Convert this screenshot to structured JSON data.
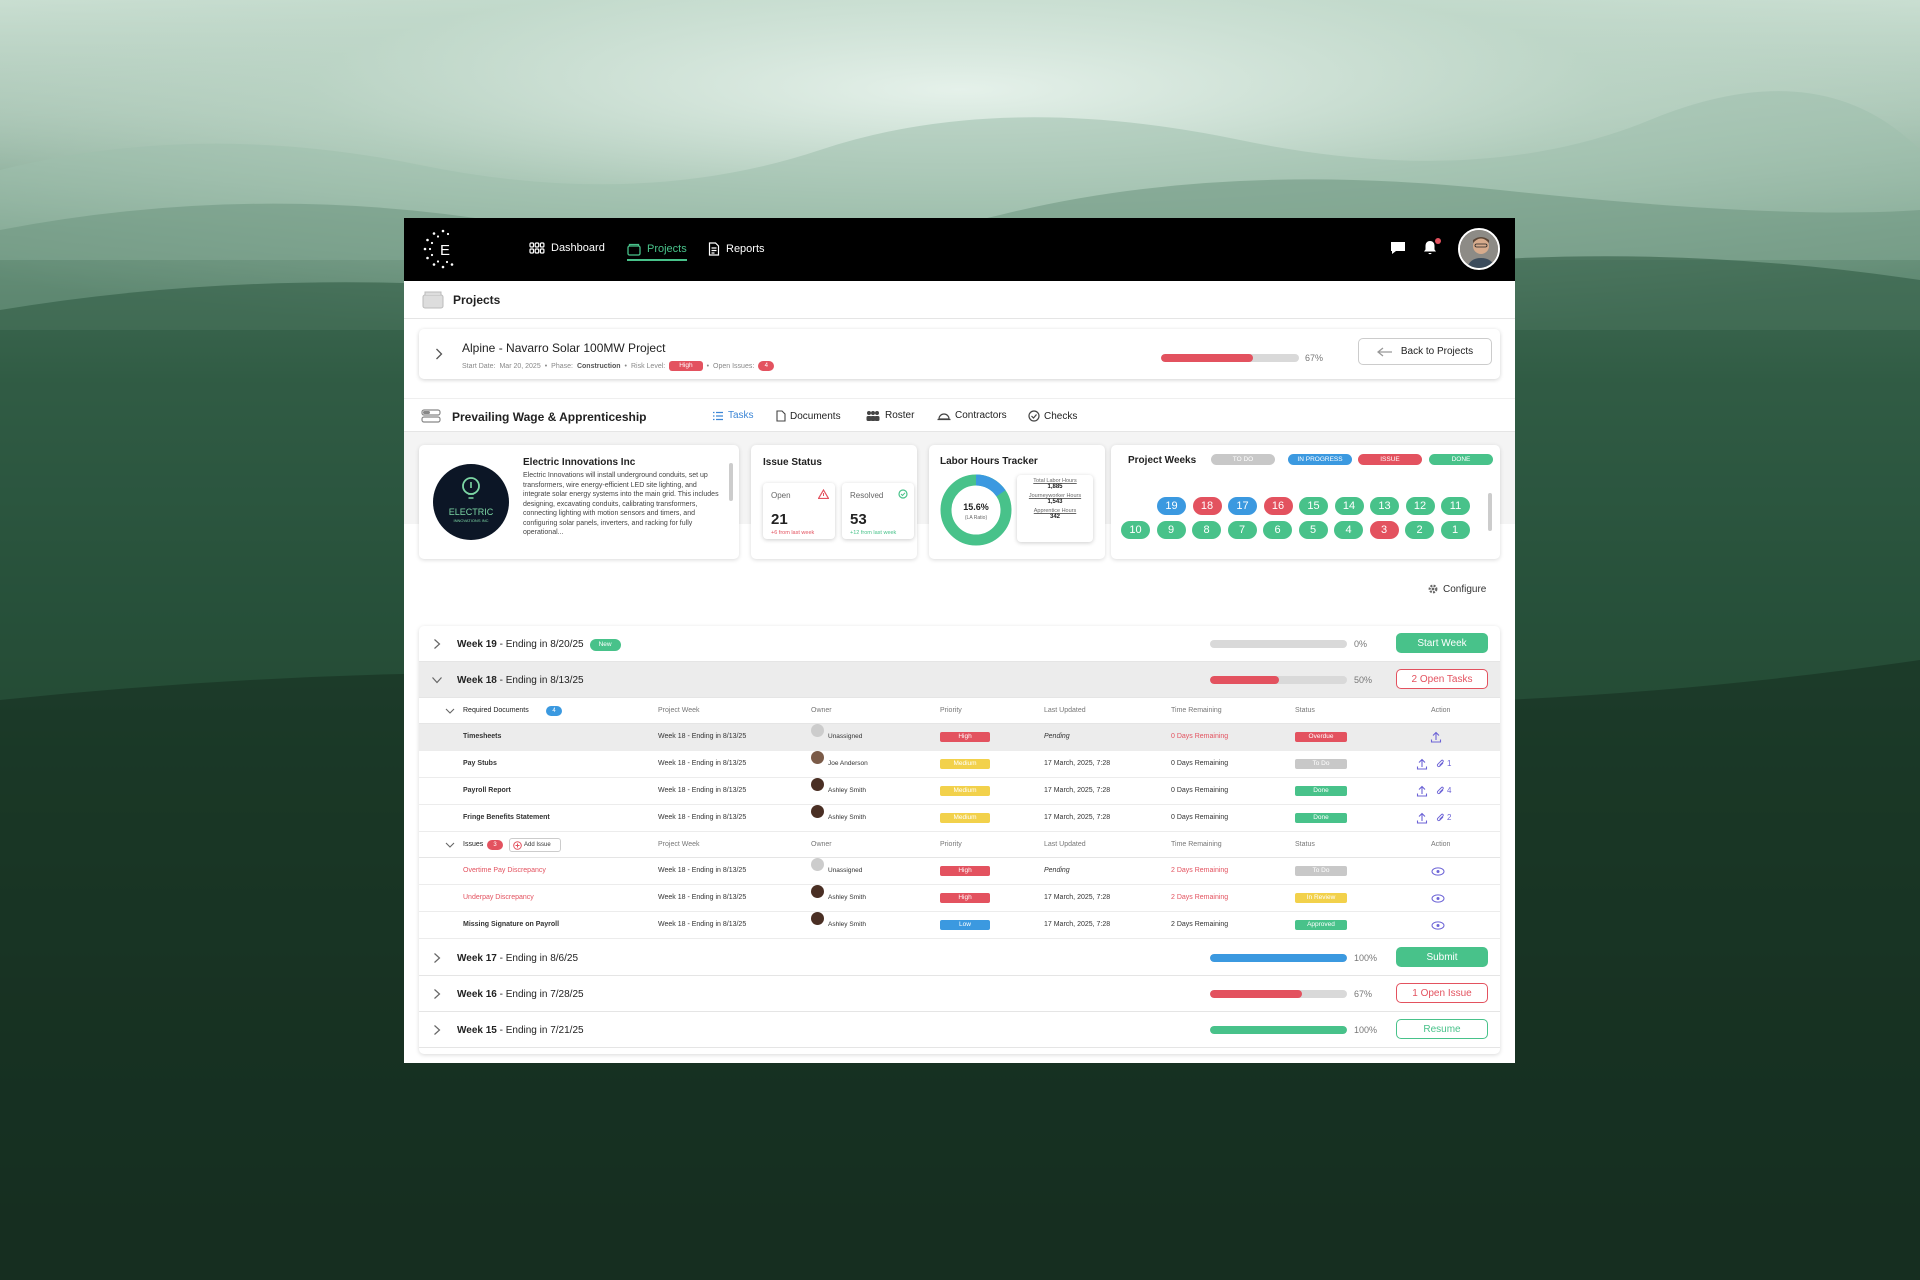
{
  "colors": {
    "green": "#48c28a",
    "red": "#e3525f",
    "blue": "#3b99e0",
    "yellow": "#f2d14b",
    "grey": "#c8c8c8"
  },
  "nav": {
    "dashboard": "Dashboard",
    "projects": "Projects",
    "reports": "Reports"
  },
  "page_title": "Projects",
  "project": {
    "name": "Alpine - Navarro Solar 100MW Project",
    "start_label": "Start Date:",
    "start_date": "Mar 20, 2025",
    "phase_label": "Phase:",
    "phase": "Construction",
    "risk_label": "Risk Level:",
    "risk": "High",
    "issues_label": "Open Issues:",
    "issues": "4",
    "progress": 0.67,
    "progress_label": "67%",
    "back": "Back to Projects"
  },
  "section": {
    "title": "Prevailing Wage & Apprenticeship",
    "tabs": [
      "Tasks",
      "Documents",
      "Roster",
      "Contractors",
      "Checks"
    ]
  },
  "company": {
    "name": "Electric Innovations Inc",
    "logo_top": "ELECTRIC",
    "logo_bottom": "INNOVATIONS INC",
    "description": "Electric Innovations will install underground conduits, set up transformers, wire energy-efficient LED site lighting, and integrate solar energy systems into the main grid. This includes designing, excavating conduits, calibrating transformers, connecting lighting with motion sensors and timers, and configuring solar panels, inverters, and racking for fully operational..."
  },
  "issue_status": {
    "title": "Issue Status",
    "open_label": "Open",
    "open_value": "21",
    "open_delta": "+6 from last week",
    "resolved_label": "Resolved",
    "resolved_value": "53",
    "resolved_delta": "+12 from last week"
  },
  "labor": {
    "title": "Labor Hours Tracker",
    "ratio": "15.6%",
    "ratio_label": "(LA Ratio)",
    "apprentice_fraction": 0.156,
    "total_label": "Total Labor Hours",
    "total": "1,885",
    "journey_label": "Journeyworker Hours",
    "journey": "1,543",
    "apprentice_label": "Apprentice Hours",
    "apprentice": "342"
  },
  "weeks_card": {
    "title": "Project Weeks",
    "legend": [
      "TO DO",
      "IN PROGRESS",
      "ISSUE",
      "DONE"
    ],
    "row1": [
      {
        "n": "19",
        "s": "blue"
      },
      {
        "n": "18",
        "s": "red"
      },
      {
        "n": "17",
        "s": "blue"
      },
      {
        "n": "16",
        "s": "red"
      },
      {
        "n": "15",
        "s": "green"
      },
      {
        "n": "14",
        "s": "green"
      },
      {
        "n": "13",
        "s": "green"
      },
      {
        "n": "12",
        "s": "green"
      },
      {
        "n": "11",
        "s": "green"
      }
    ],
    "row2": [
      {
        "n": "10",
        "s": "green"
      },
      {
        "n": "9",
        "s": "green"
      },
      {
        "n": "8",
        "s": "green"
      },
      {
        "n": "7",
        "s": "green"
      },
      {
        "n": "6",
        "s": "green"
      },
      {
        "n": "5",
        "s": "green"
      },
      {
        "n": "4",
        "s": "green"
      },
      {
        "n": "3",
        "s": "red"
      },
      {
        "n": "2",
        "s": "green"
      },
      {
        "n": "1",
        "s": "green"
      }
    ]
  },
  "configure": "Configure",
  "weeks": [
    {
      "week": "Week 19",
      "ending": " - Ending in 8/20/25",
      "badge": "New",
      "progress": 0,
      "pct": "0%",
      "action": "Start Week"
    },
    {
      "week": "Week 18",
      "ending": " - Ending in 8/13/25",
      "progress": 0.5,
      "pct": "50%",
      "action": "2 Open Tasks"
    },
    {
      "week": "Week 17",
      "ending": " - Ending in 8/6/25",
      "progress": 1,
      "pct": "100%",
      "action": "Submit"
    },
    {
      "week": "Week 16",
      "ending": " - Ending in 7/28/25",
      "progress": 0.67,
      "pct": "67%",
      "action": "1 Open Issue"
    },
    {
      "week": "Week 15",
      "ending": " - Ending in 7/21/25",
      "progress": 1,
      "pct": "100%",
      "action": "Resume"
    }
  ],
  "table_headers": {
    "project_week": "Project Week",
    "owner": "Owner",
    "priority": "Priority",
    "last_updated": "Last Updated",
    "time_remaining": "Time Remaining",
    "status": "Status",
    "action": "Action"
  },
  "required_docs": {
    "label": "Required Documents",
    "count": "4",
    "rows": [
      {
        "name": "Timesheets",
        "week": "Week 18 - Ending in 8/13/25",
        "owner": "Unassigned",
        "priority": "High",
        "updated": "Pending",
        "time": "0 Days Remaining",
        "status": "Overdue",
        "attach": ""
      },
      {
        "name": "Pay Stubs",
        "week": "Week 18 - Ending in 8/13/25",
        "owner": "Joe Anderson",
        "priority": "Medium",
        "updated": "17 March, 2025, 7:28",
        "time": "0 Days Remaining",
        "status": "To Do",
        "attach": "1"
      },
      {
        "name": "Payroll Report",
        "week": "Week 18 - Ending in 8/13/25",
        "owner": "Ashley Smith",
        "priority": "Medium",
        "updated": "17 March, 2025, 7:28",
        "time": "0 Days Remaining",
        "status": "Done",
        "attach": "4"
      },
      {
        "name": "Fringe Benefits Statement",
        "week": "Week 18 - Ending in 8/13/25",
        "owner": "Ashley Smith",
        "priority": "Medium",
        "updated": "17 March, 2025, 7:28",
        "time": "0 Days Remaining",
        "status": "Done",
        "attach": "2"
      }
    ]
  },
  "issues": {
    "label": "Issues",
    "count": "3",
    "add": "Add Issue",
    "rows": [
      {
        "name": "Overtime Pay Discrepancy",
        "week": "Week 18 - Ending in 8/13/25",
        "owner": "Unassigned",
        "priority": "High",
        "updated": "Pending",
        "time": "2 Days Remaining",
        "status": "To Do"
      },
      {
        "name": "Underpay Discrepancy",
        "week": "Week 18 - Ending in 8/13/25",
        "owner": "Ashley Smith",
        "priority": "High",
        "updated": "17 March, 2025, 7:28",
        "time": "2 Days Remaining",
        "status": "In Review"
      },
      {
        "name": "Missing Signature on Payroll",
        "week": "Week 18 - Ending in 8/13/25",
        "owner": "Ashley Smith",
        "priority": "Low",
        "updated": "17 March, 2025, 7:28",
        "time": "2 Days Remaining",
        "status": "Approved"
      }
    ]
  }
}
